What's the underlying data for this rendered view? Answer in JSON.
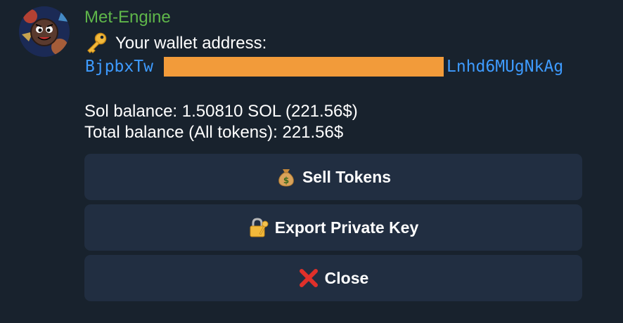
{
  "sender": {
    "name": "Met-Engine",
    "name_color": "#5fb64a",
    "avatar": "bot-avatar-icon"
  },
  "message": {
    "wallet_icon": "key-icon",
    "wallet_label": "Your wallet address:",
    "address_prefix": "BjpbxTw",
    "address_suffix": "Lnhd6MUgNkAg",
    "address_color": "#3e9bff",
    "redaction_color": "#f29b3a",
    "sol_balance": "Sol balance: 1.50810 SOL (221.56$)",
    "total_balance": "Total balance (All tokens): 221.56$"
  },
  "keyboard": {
    "sell": {
      "icon": "money-bag-icon",
      "label": "Sell Tokens"
    },
    "export": {
      "icon": "locked-with-key-icon",
      "label": "Export Private Key"
    },
    "close": {
      "icon": "red-x-icon",
      "label": "Close"
    }
  },
  "colors": {
    "background": "#18222d",
    "button_background": "#212e41"
  }
}
